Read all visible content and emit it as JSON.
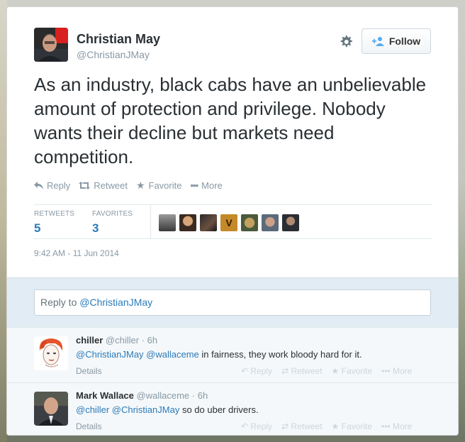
{
  "tweet": {
    "author_name": "Christian May",
    "author_handle": "@ChristianJMay",
    "follow_label": "Follow",
    "text": "As an industry, black cabs have an unbelievable amount of protection and privilege. Nobody wants their decline but markets need competition.",
    "actions": {
      "reply": "Reply",
      "retweet": "Retweet",
      "favorite": "Favorite",
      "more": "More"
    },
    "stats": {
      "retweets_label": "RETWEETS",
      "retweets_count": "5",
      "favorites_label": "FAVORITES",
      "favorites_count": "3"
    },
    "timestamp": "9:42 AM - 11 Jun 2014",
    "favoriter_avatars": 7
  },
  "reply_box": {
    "prefix": "Reply to ",
    "mention": "@ChristianJMay"
  },
  "replies": [
    {
      "name": "chiller",
      "handle": "@chiller",
      "time": "· 6h",
      "mentions": "@ChristianJMay @wallaceme",
      "text": " in fairness, they work bloody hard for it.",
      "details": "Details"
    },
    {
      "name": "Mark Wallace",
      "handle": "@wallaceme",
      "time": "· 6h",
      "mentions": "@chiller @ChristianJMay",
      "text": " so do uber drivers.",
      "details": "Details"
    }
  ],
  "reply_actions": {
    "reply": "Reply",
    "retweet": "Retweet",
    "favorite": "Favorite",
    "more": "More"
  },
  "colors": {
    "link": "#2b7bb9",
    "text": "#292f33",
    "muted": "#8899a6",
    "reply_bg": "#e1ecf4"
  }
}
